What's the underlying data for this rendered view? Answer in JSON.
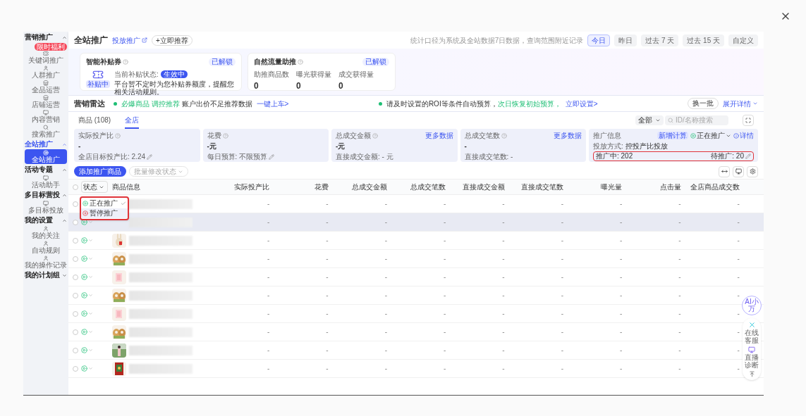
{
  "sidebar": {
    "groups": [
      {
        "label": "营销推广",
        "expanded": true,
        "items": [
          {
            "label": "关键词推广",
            "selected": false,
            "badge": "限时福利"
          },
          {
            "label": "人群推广",
            "selected": false
          },
          {
            "label": "全品运营",
            "selected": false
          },
          {
            "label": "店铺运营",
            "selected": false
          },
          {
            "label": "内容营销",
            "selected": false
          },
          {
            "label": "搜索推广",
            "selected": false
          }
        ]
      },
      {
        "label": "全站推广",
        "expanded": true,
        "items": [
          {
            "label": "全站推广",
            "selected": true
          }
        ]
      },
      {
        "label": "活动专题",
        "expanded": true,
        "items": [
          {
            "label": "活动助手",
            "selected": false
          }
        ]
      },
      {
        "label": "多目标营投",
        "expanded": true,
        "items": [
          {
            "label": "多目标投放",
            "selected": false
          }
        ]
      },
      {
        "label": "我的设置",
        "expanded": true,
        "items": [
          {
            "label": "我的关注",
            "selected": false
          },
          {
            "label": "自动规则",
            "selected": false
          },
          {
            "label": "我的操作记录",
            "selected": false
          }
        ]
      },
      {
        "label": "我的计划组",
        "expanded": false
      }
    ]
  },
  "header": {
    "title": "全站推广",
    "link": "投放推广",
    "add_button": "+立即推荐",
    "hint": "统计口径为系统及全站数据7日数据，查询范围附近记录",
    "ranges": [
      {
        "label": "今日",
        "selected": true
      },
      {
        "label": "昨日",
        "selected": false
      },
      {
        "label": "过去 7 天",
        "selected": false
      },
      {
        "label": "过去 15 天",
        "selected": false
      },
      {
        "label": "自定义",
        "selected": false
      }
    ]
  },
  "subsidy": {
    "title": "智能补贴券",
    "status_badge": "已解锁",
    "status_label": "当前补贴状态:",
    "status_value": "生效中",
    "icon_badge": "补贴中",
    "desc": "平台暂不定时为您补贴券额度，提醒您相关活动规则。"
  },
  "flow": {
    "title": "自然流量助推",
    "status_badge": "已解锁",
    "stats": [
      {
        "label": "助推商品数",
        "value": "0"
      },
      {
        "label": "曝光获得量",
        "value": "0"
      },
      {
        "label": "成交获得量",
        "value": "0"
      }
    ]
  },
  "radar": {
    "title": "营销雷达",
    "tips": [
      {
        "highlight": "必爆商品 调控推荐",
        "text": "账户出价不足推荐数据",
        "link": "一键上车>"
      },
      {
        "highlight": "次日恢复初始预算，",
        "text": "请及时设置的ROI等条件自动预算，",
        "link": "立即设置>"
      }
    ],
    "refresh": "换一批",
    "expand": "展开详情"
  },
  "tabs": [
    {
      "label": "商品 (108)",
      "selected": false
    },
    {
      "label": "全店",
      "selected": true
    }
  ],
  "filter": {
    "value": "全部",
    "placeholder": "ID/名称搜索"
  },
  "metrics": [
    {
      "label": "实际投产比",
      "value": "-",
      "sub": "全店目标投产比: 2.24"
    },
    {
      "label": "花费",
      "value": "-元",
      "sub": "每日预算: 不限预算"
    },
    {
      "label": "总成交金额",
      "value": "-元",
      "sub": "直接成交金额: - 元",
      "more": "更多数据"
    },
    {
      "label": "总成交笔数",
      "value": "-",
      "sub": "直接成交笔数: -",
      "more": "更多数据"
    }
  ],
  "promo": {
    "title": "推广信息",
    "tag": "新增计算",
    "status": "正在推广",
    "detail": "详情",
    "mode_label": "投放方式:",
    "mode_value": "控投产比投放",
    "running": "推广中: 202",
    "pending": "待推广: 20"
  },
  "actions": {
    "add": "添加推广商品",
    "batch": "批量修改状态"
  },
  "table": {
    "select_all_checked": false,
    "status_filter": "状态",
    "product_column": "商品信息",
    "columns": [
      "实际投产比",
      "花费",
      "总成交金额",
      "总成交笔数",
      "直接成交金额",
      "直接成交笔数",
      "曝光量",
      "点击量",
      "全店商品成交数"
    ],
    "rows": [
      {
        "checked": false,
        "selected": false,
        "cells": [
          "-",
          "-",
          "-",
          "-",
          "-",
          "-",
          "-",
          "-",
          "-"
        ]
      },
      {
        "checked": false,
        "selected": true,
        "cells": [
          "-",
          "-",
          "-",
          "-",
          "-",
          "-",
          "-",
          "-",
          "-"
        ]
      },
      {
        "checked": false,
        "selected": false,
        "cells": [
          "-",
          "-",
          "-",
          "-",
          "-",
          "-",
          "-",
          "-",
          "-"
        ]
      },
      {
        "checked": false,
        "selected": false,
        "cells": [
          "-",
          "-",
          "-",
          "-",
          "-",
          "-",
          "-",
          "-",
          "-"
        ]
      },
      {
        "checked": false,
        "selected": false,
        "cells": [
          "-",
          "-",
          "-",
          "-",
          "-",
          "-",
          "-",
          "-",
          "-"
        ]
      },
      {
        "checked": false,
        "selected": false,
        "cells": [
          "-",
          "-",
          "-",
          "-",
          "-",
          "-",
          "-",
          "-",
          "-"
        ]
      },
      {
        "checked": false,
        "selected": false,
        "cells": [
          "-",
          "-",
          "-",
          "-",
          "-",
          "-",
          "-",
          "-",
          "-"
        ]
      },
      {
        "checked": false,
        "selected": false,
        "cells": [
          "-",
          "-",
          "-",
          "-",
          "-",
          "-",
          "-",
          "-",
          "-"
        ]
      },
      {
        "checked": false,
        "selected": false,
        "cells": [
          "-",
          "-",
          "-",
          "-",
          "-",
          "-",
          "-",
          "-",
          "-"
        ]
      },
      {
        "checked": false,
        "selected": false,
        "cells": [
          "-",
          "-",
          "-",
          "-",
          "-",
          "-",
          "-",
          "-",
          "-"
        ]
      }
    ]
  },
  "status_menu": [
    {
      "label": "正在推广",
      "selected": true
    },
    {
      "label": "暂停推广",
      "selected": false
    }
  ],
  "float": {
    "assistant": "AI小万",
    "items": [
      "在线客服",
      "直播诊断"
    ]
  }
}
